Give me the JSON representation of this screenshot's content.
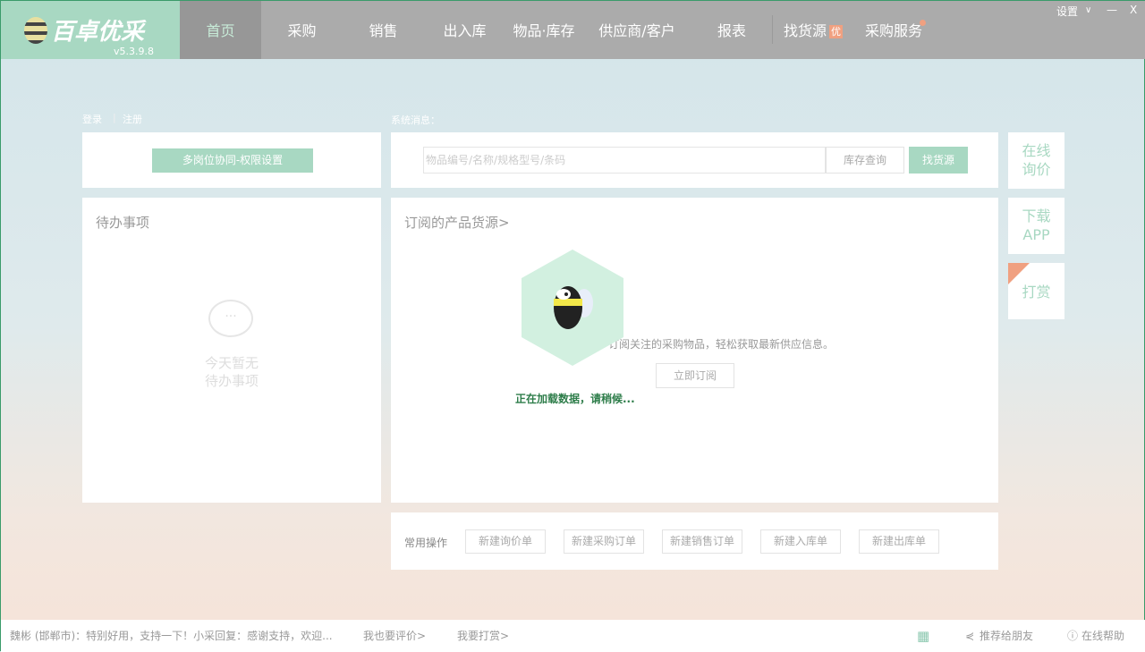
{
  "app": {
    "name": "百卓优采",
    "version": "v5.3.9.8"
  },
  "nav": [
    {
      "label": "首页",
      "active": true
    },
    {
      "label": "采购"
    },
    {
      "label": "销售"
    },
    {
      "label": "出入库"
    },
    {
      "label": "物品·库存"
    },
    {
      "label": "供应商/客户"
    },
    {
      "label": "报表"
    },
    {
      "label": "找货源",
      "badge": "优"
    },
    {
      "label": "采购服务"
    }
  ],
  "window": {
    "settings": "设置",
    "chevron": "∨",
    "minimize": "—",
    "close": "X"
  },
  "auth": {
    "login": "登录",
    "register": "注册"
  },
  "permissions_button": "多岗位协同-权限设置",
  "system_msg_label": "系统消息：",
  "search": {
    "placeholder": "物品编号/名称/规格型号/条码",
    "stock_query": "库存查询",
    "find_source": "找货源"
  },
  "todo": {
    "title": "待办事项",
    "empty_line1": "今天暂无",
    "empty_line2": "待办事项"
  },
  "subscribe": {
    "title": "订阅的产品货源>",
    "desc": "订阅关注的采购物品，轻松获取最新供应信息。",
    "button": "立即订阅",
    "loading": "正在加载数据，请稍候..."
  },
  "quick": {
    "label": "常用操作",
    "buttons": [
      "新建询价单",
      "新建采购订单",
      "新建销售订单",
      "新建入库单",
      "新建出库单"
    ]
  },
  "side": {
    "inquiry": [
      "在线",
      "询价"
    ],
    "download": [
      "下载",
      "APP"
    ],
    "reward": "打赏"
  },
  "footer": {
    "message": "魏彬 (邯郸市)：特别好用，支持一下！小采回复：感谢支持，欢迎...",
    "rate": "我也要评价>",
    "tip": "我要打赏>",
    "recommend": "推荐给朋友",
    "help": "在线帮助"
  },
  "colors": {
    "accent": "#a8d8c2",
    "header": "#ababab",
    "badge": "#f0a080",
    "loading": "#2e7d4a"
  }
}
